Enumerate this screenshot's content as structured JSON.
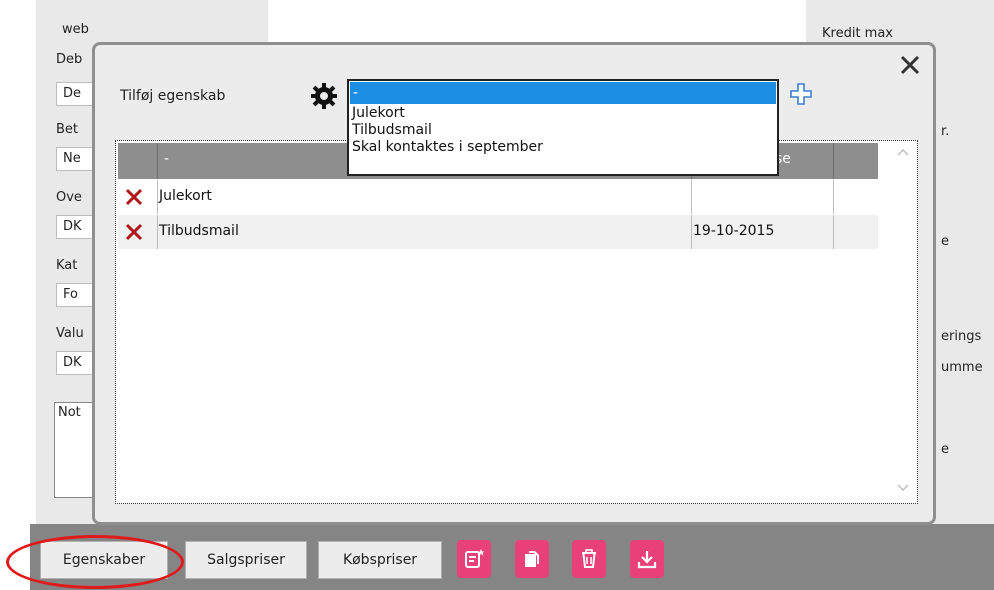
{
  "background_form": {
    "left_labels": [
      "web",
      "Deb",
      "Bet",
      "Ove",
      "Kat",
      "Valu"
    ],
    "left_inputs": [
      "De",
      "Ne",
      "DK",
      "Fo",
      "DK"
    ],
    "notes_label": "Not",
    "right_labels": [
      "Kredit max",
      "r.",
      "e",
      "erings",
      "umme",
      "e"
    ]
  },
  "modal": {
    "add_property_label": "Tilføj egenskab",
    "dropdown": {
      "selected": "-",
      "options": [
        "Julekort",
        "Tilbudsmail",
        "Skal kontaktes i september"
      ]
    },
    "table": {
      "headers": [
        "",
        "-",
        "se"
      ],
      "rows": [
        {
          "name": "Julekort",
          "date": ""
        },
        {
          "name": "Tilbudsmail",
          "date": "19-10-2015"
        }
      ]
    }
  },
  "bottom_bar": {
    "buttons": [
      "Egenskaber",
      "Salgspriser",
      "Købspriser"
    ],
    "icons": [
      "new-document-icon",
      "copy-icon",
      "trash-icon",
      "download-icon"
    ]
  },
  "colors": {
    "accent_pink": "#e8417a",
    "highlight_red": "#e01a1a",
    "select_blue": "#1c8ee3",
    "delete_red": "#b01818"
  }
}
